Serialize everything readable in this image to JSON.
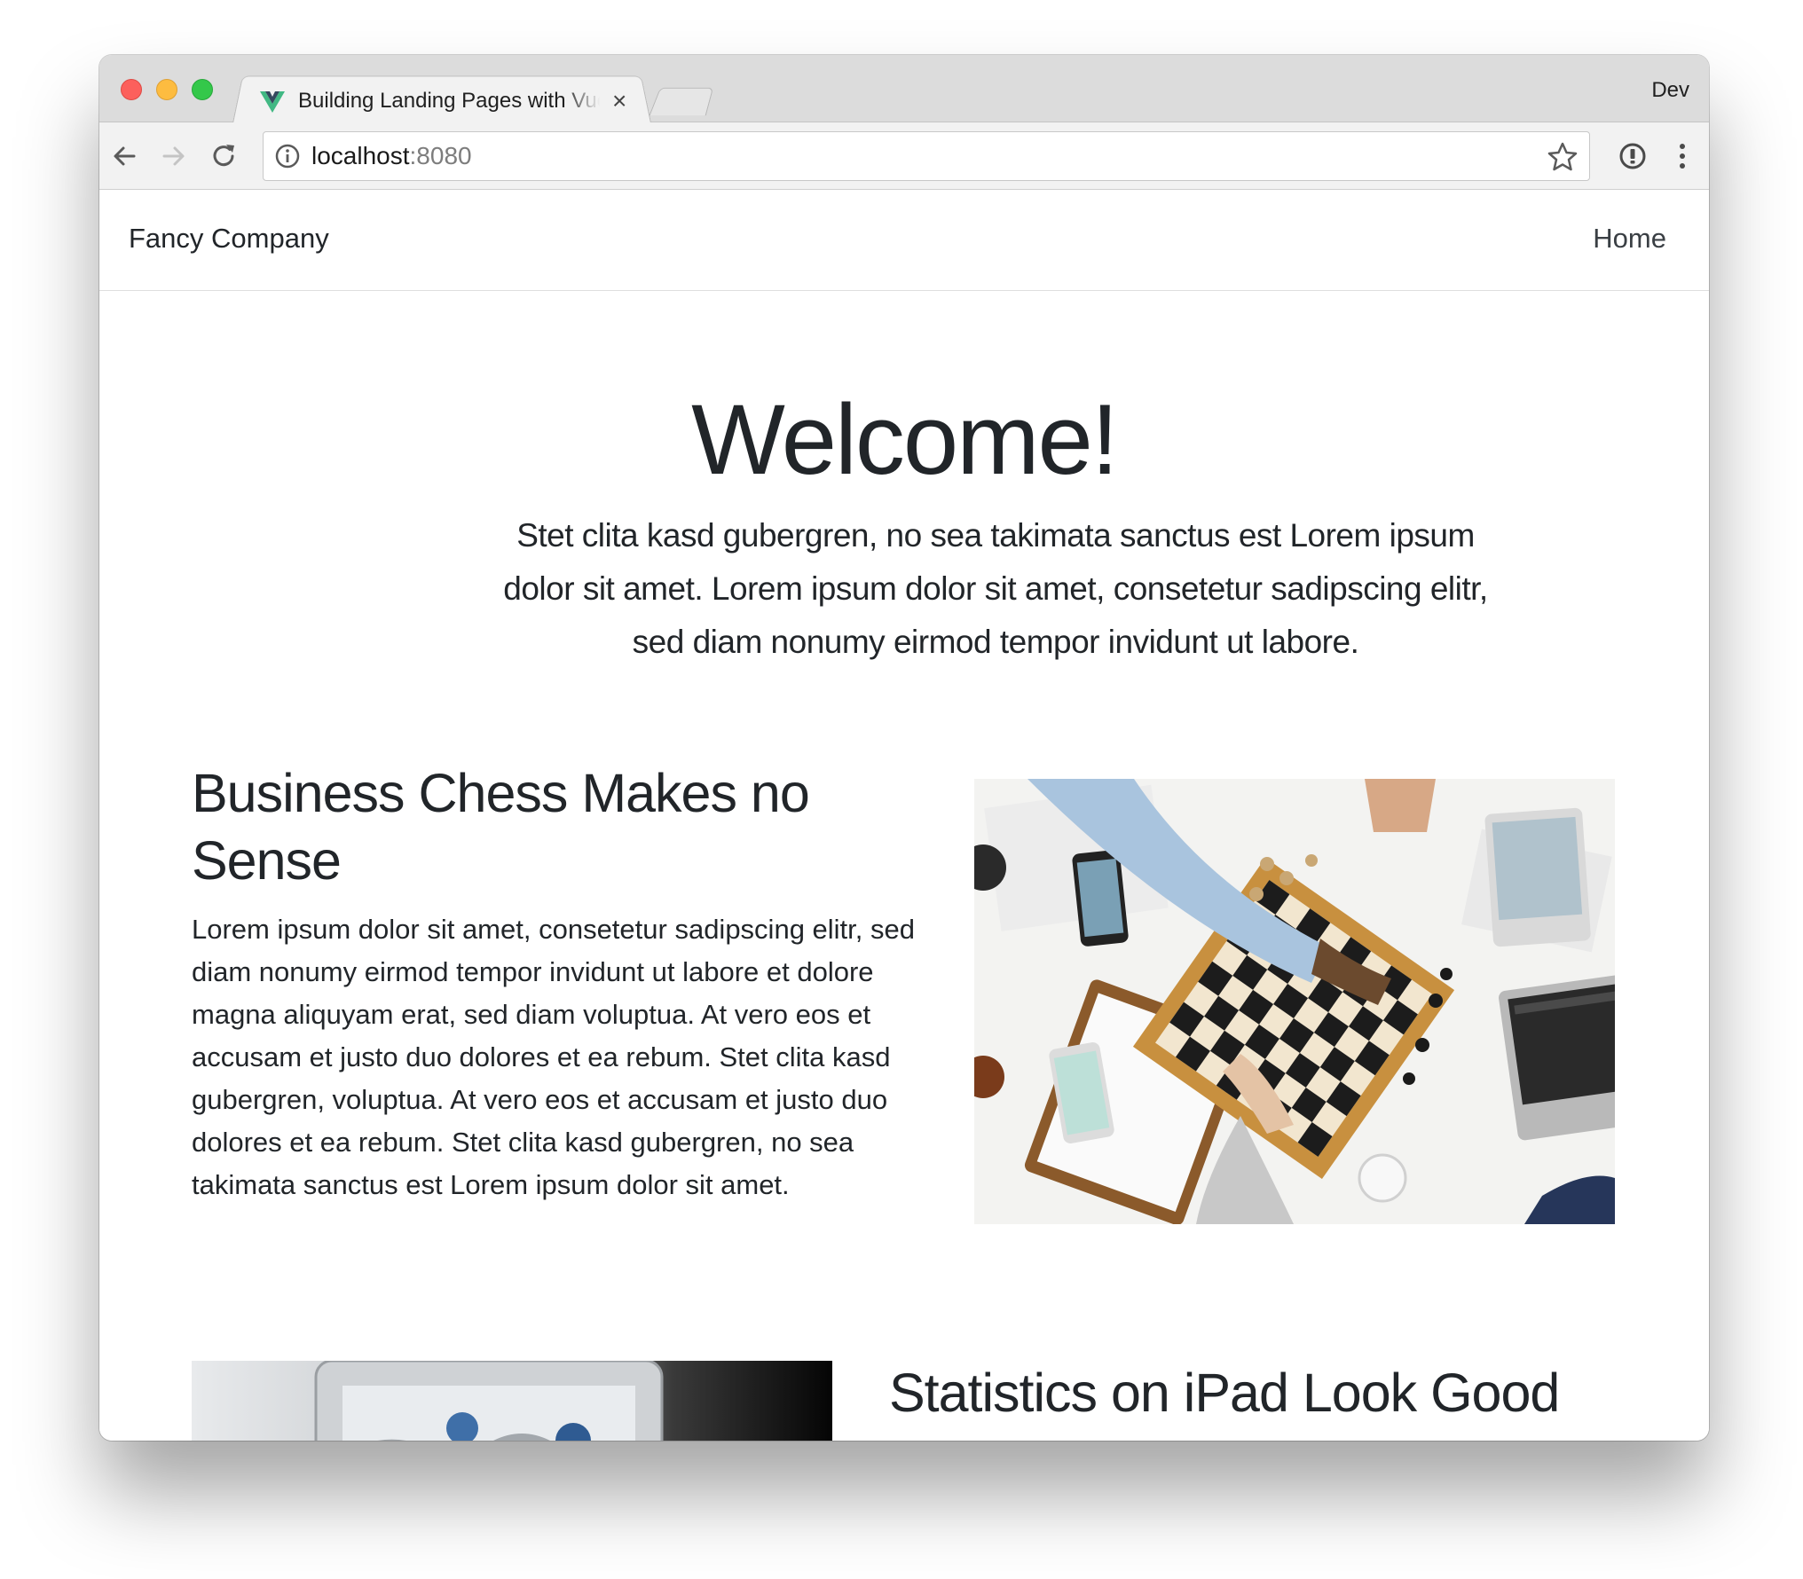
{
  "browser": {
    "tab_title": "Building Landing Pages with Vue",
    "tab_close": "×",
    "profile_label": "Dev",
    "address": {
      "host": "localhost",
      "port": ":8080"
    },
    "icons": [
      "back-arrow-icon",
      "forward-arrow-icon",
      "reload-icon",
      "info-icon",
      "star-icon",
      "extension-icon",
      "menu-dots-icon",
      "vue-favicon-icon"
    ]
  },
  "navbar": {
    "brand": "Fancy Company",
    "links": [
      "Home"
    ]
  },
  "hero": {
    "title": "Welcome!",
    "lead": "Stet clita kasd gubergren, no sea takimata sanctus est Lorem ipsum dolor sit amet. Lorem ipsum dolor sit amet, consetetur sadipscing elitr, sed diam nonumy eirmod tempor invidunt ut labore."
  },
  "features": [
    {
      "title": "Business Chess Makes no Sense",
      "text": "Lorem ipsum dolor sit amet, consetetur sadipscing elitr, sed diam nonumy eirmod tempor invidunt ut labore et dolore magna aliquyam erat, sed diam voluptua. At vero eos et accusam et justo duo dolores et ea rebum. Stet clita kasd gubergren, voluptua. At vero eos et accusam et justo duo dolores et ea rebum. Stet clita kasd gubergren, no sea takimata sanctus est Lorem ipsum dolor sit amet."
    },
    {
      "title": "Statistics on iPad Look Good"
    }
  ],
  "colors": {
    "text": "#212529",
    "traffic_red": "#fc605c",
    "traffic_yellow": "#fdbc40",
    "traffic_green": "#34c84a",
    "vue_green": "#41b883",
    "vue_dark": "#35495e"
  }
}
